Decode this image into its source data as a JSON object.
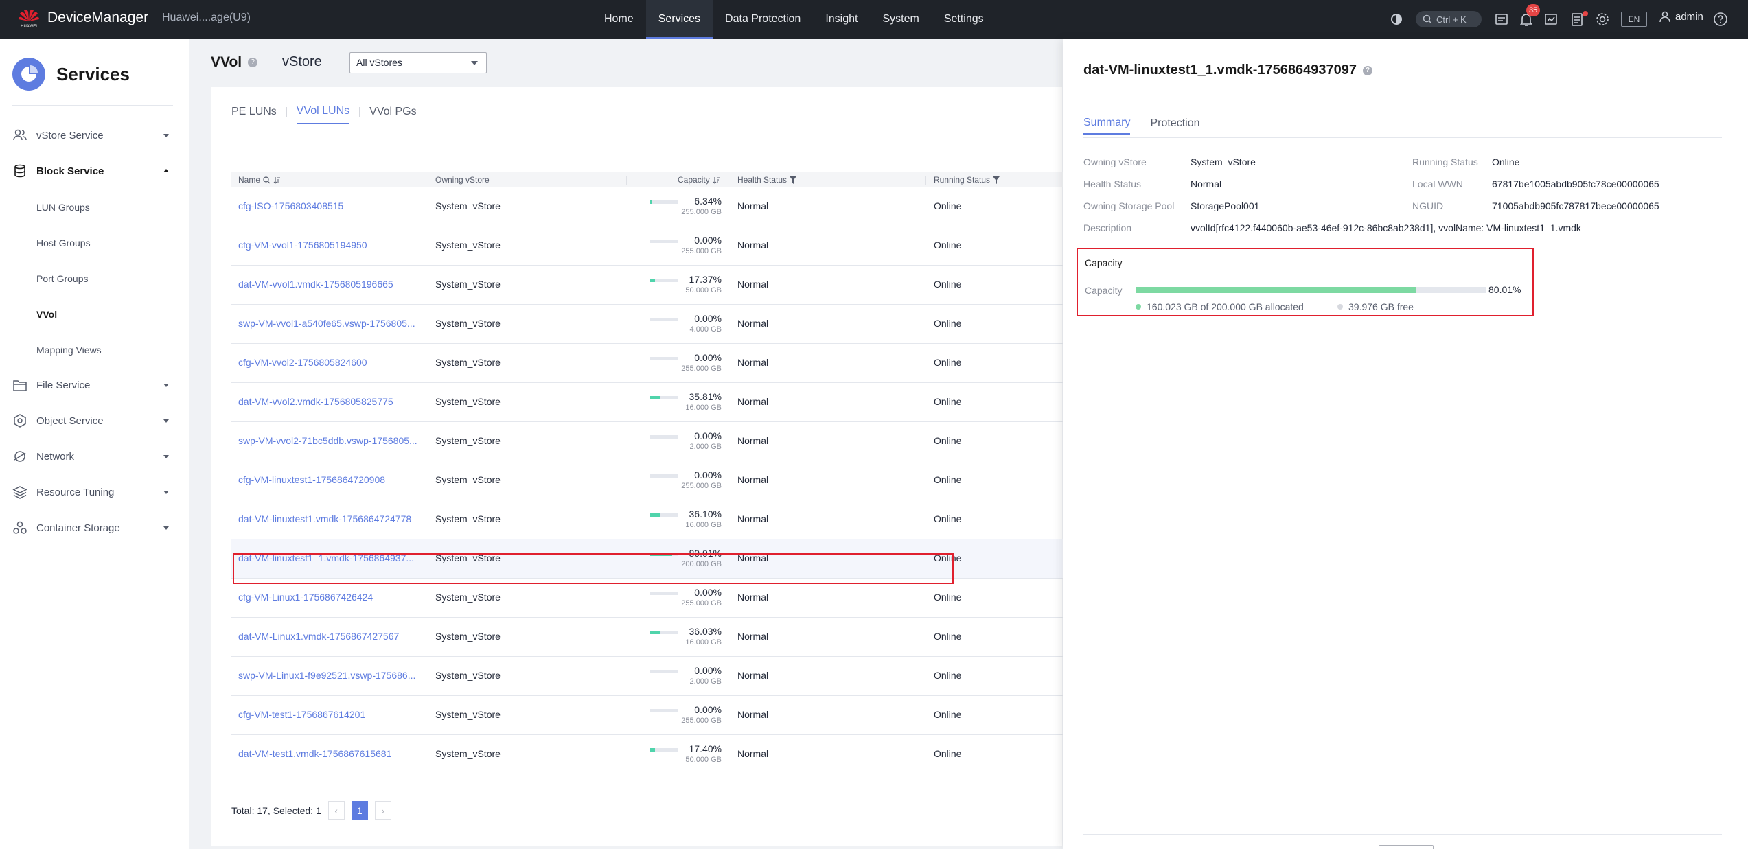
{
  "topbar": {
    "brand": "DeviceManager",
    "logo_text": "HUAWEI",
    "device": "Huawei....age(U9)",
    "nav": [
      {
        "label": "Home",
        "active": false
      },
      {
        "label": "Services",
        "active": true
      },
      {
        "label": "Data Protection",
        "active": false
      },
      {
        "label": "Insight",
        "active": false
      },
      {
        "label": "System",
        "active": false
      },
      {
        "label": "Settings",
        "active": false
      }
    ],
    "search_shortcut": "Ctrl + K",
    "notifications_count": "35",
    "lang": "EN",
    "user": "admin"
  },
  "sidebar": {
    "title": "Services",
    "items": [
      {
        "label": "vStore Service",
        "icon": "users-icon"
      },
      {
        "label": "Block Service",
        "icon": "database-icon"
      },
      {
        "label": "File Service",
        "icon": "folder-icon"
      },
      {
        "label": "Object Service",
        "icon": "hexagon-icon"
      },
      {
        "label": "Network",
        "icon": "network-icon"
      },
      {
        "label": "Resource Tuning",
        "icon": "layers-icon"
      },
      {
        "label": "Container Storage",
        "icon": "container-icon"
      }
    ],
    "block_sub": [
      "LUN Groups",
      "Host Groups",
      "Port Groups",
      "VVol",
      "Mapping Views"
    ]
  },
  "main": {
    "title": "VVol",
    "vstore_label": "vStore",
    "vstore_select": "All vStores",
    "tabs": [
      "PE LUNs",
      "VVol LUNs",
      "VVol PGs"
    ],
    "columns": [
      "Name",
      "Owning vStore",
      "Capacity",
      "Health Status",
      "Running Status"
    ],
    "rows": [
      {
        "name": "cfg-ISO-1756803408515",
        "owner": "System_vStore",
        "pct": "6.34%",
        "pct_value": 6.34,
        "cap": "255.000 GB",
        "health": "Normal",
        "running": "Online"
      },
      {
        "name": "cfg-VM-vvol1-1756805194950",
        "owner": "System_vStore",
        "pct": "0.00%",
        "pct_value": 0,
        "cap": "255.000 GB",
        "health": "Normal",
        "running": "Online"
      },
      {
        "name": "dat-VM-vvol1.vmdk-1756805196665",
        "owner": "System_vStore",
        "pct": "17.37%",
        "pct_value": 17.37,
        "cap": "50.000 GB",
        "health": "Normal",
        "running": "Online"
      },
      {
        "name": "swp-VM-vvol1-a540fe65.vswp-1756805...",
        "owner": "System_vStore",
        "pct": "0.00%",
        "pct_value": 0,
        "cap": "4.000 GB",
        "health": "Normal",
        "running": "Online"
      },
      {
        "name": "cfg-VM-vvol2-1756805824600",
        "owner": "System_vStore",
        "pct": "0.00%",
        "pct_value": 0,
        "cap": "255.000 GB",
        "health": "Normal",
        "running": "Online"
      },
      {
        "name": "dat-VM-vvol2.vmdk-1756805825775",
        "owner": "System_vStore",
        "pct": "35.81%",
        "pct_value": 35.81,
        "cap": "16.000 GB",
        "health": "Normal",
        "running": "Online"
      },
      {
        "name": "swp-VM-vvol2-71bc5ddb.vswp-1756805...",
        "owner": "System_vStore",
        "pct": "0.00%",
        "pct_value": 0,
        "cap": "2.000 GB",
        "health": "Normal",
        "running": "Online"
      },
      {
        "name": "cfg-VM-linuxtest1-1756864720908",
        "owner": "System_vStore",
        "pct": "0.00%",
        "pct_value": 0,
        "cap": "255.000 GB",
        "health": "Normal",
        "running": "Online"
      },
      {
        "name": "dat-VM-linuxtest1.vmdk-1756864724778",
        "owner": "System_vStore",
        "pct": "36.10%",
        "pct_value": 36.1,
        "cap": "16.000 GB",
        "health": "Normal",
        "running": "Online"
      },
      {
        "name": "dat-VM-linuxtest1_1.vmdk-1756864937...",
        "owner": "System_vStore",
        "pct": "80.01%",
        "pct_value": 80.01,
        "cap": "200.000 GB",
        "health": "Normal",
        "running": "Online",
        "selected": true
      },
      {
        "name": "cfg-VM-Linux1-1756867426424",
        "owner": "System_vStore",
        "pct": "0.00%",
        "pct_value": 0,
        "cap": "255.000 GB",
        "health": "Normal",
        "running": "Online"
      },
      {
        "name": "dat-VM-Linux1.vmdk-1756867427567",
        "owner": "System_vStore",
        "pct": "36.03%",
        "pct_value": 36.03,
        "cap": "16.000 GB",
        "health": "Normal",
        "running": "Online"
      },
      {
        "name": "swp-VM-Linux1-f9e92521.vswp-175686...",
        "owner": "System_vStore",
        "pct": "0.00%",
        "pct_value": 0,
        "cap": "2.000 GB",
        "health": "Normal",
        "running": "Online"
      },
      {
        "name": "cfg-VM-test1-1756867614201",
        "owner": "System_vStore",
        "pct": "0.00%",
        "pct_value": 0,
        "cap": "255.000 GB",
        "health": "Normal",
        "running": "Online"
      },
      {
        "name": "dat-VM-test1.vmdk-1756867615681",
        "owner": "System_vStore",
        "pct": "17.40%",
        "pct_value": 17.4,
        "cap": "50.000 GB",
        "health": "Normal",
        "running": "Online"
      }
    ],
    "footer": {
      "total": "Total: 17, Selected: 1",
      "page": "1",
      "prev": "‹",
      "next": "›"
    }
  },
  "panel": {
    "title": "dat-VM-linuxtest1_1.vmdk-1756864937097",
    "tabs": [
      "Summary",
      "Protection"
    ],
    "owning_vstore_label": "Owning vStore",
    "owning_vstore": "System_vStore",
    "health_label": "Health Status",
    "health": "Normal",
    "pool_label": "Owning Storage Pool",
    "pool": "StoragePool001",
    "desc_label": "Description",
    "desc": "vvolId[rfc4122.f440060b-ae53-46ef-912c-86bc8ab238d1], vvolName: VM-linuxtest1_1.vmdk",
    "running_label": "Running Status",
    "running": "Online",
    "wwn_label": "Local WWN",
    "wwn": "67817be1005abdb905fc78ce00000065",
    "nguid_label": "NGUID",
    "nguid": "71005abdb905fc787817bece00000065",
    "capacity": {
      "title": "Capacity",
      "label": "Capacity",
      "pct": "80.01%",
      "pct_value": 80.01,
      "allocated": "160.023 GB of 200.000 GB allocated",
      "free": "39.976 GB free",
      "allocated_color": "#7dd9a2",
      "free_color": "#d7d9df"
    }
  }
}
